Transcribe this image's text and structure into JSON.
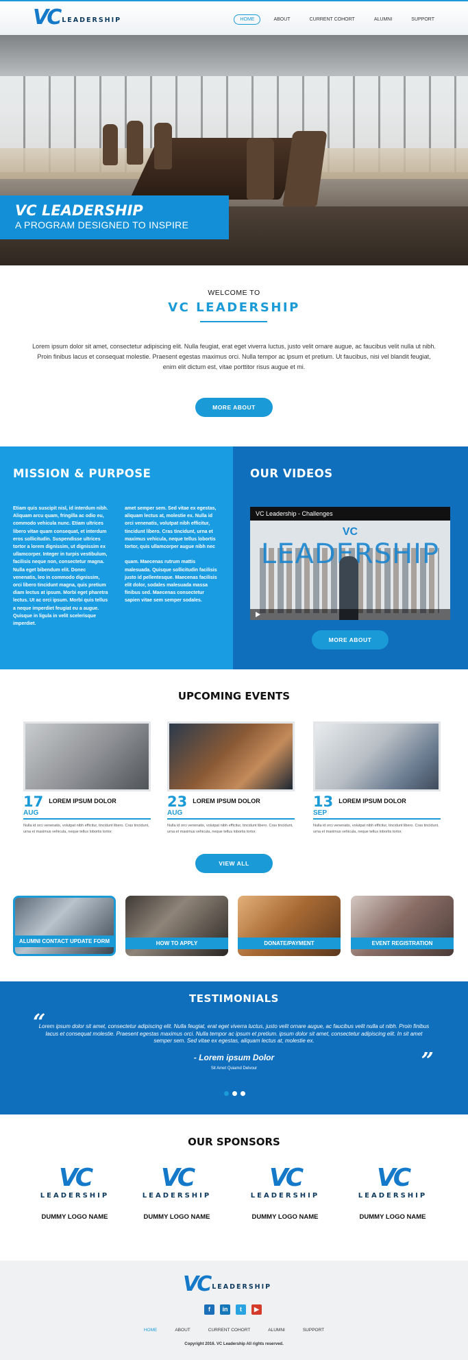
{
  "brand": {
    "vc": "VC",
    "word": "LEADERSHIP"
  },
  "nav": [
    "HOME",
    "ABOUT",
    "CURRENT COHORT",
    "ALUMNI",
    "SUPPORT"
  ],
  "hero": {
    "title": "VC LEADERSHIP",
    "subtitle": "A PROGRAM DESIGNED TO INSPIRE"
  },
  "welcome": {
    "pre": "WELCOME TO",
    "title": "VC LEADERSHIP",
    "text": "Lorem ipsum dolor sit amet, consectetur adipiscing elit. Nulla feugiat, erat eget viverra luctus, justo velit ornare augue, ac faucibus velit nulla ut nibh. Proin finibus lacus et consequat molestie. Praesent egestas maximus orci. Nulla tempor ac ipsum et pretium. Ut faucibus, nisi vel blandit feugiat, enim elit dictum est, vitae porttitor risus augue et mi.",
    "button": "MORE ABOUT"
  },
  "mission": {
    "heading": "MISSION & PURPOSE",
    "col1": "Etiam quis suscipit nisl, id interdum nibh. Aliquam arcu quam, fringilla ac odio eu, commodo vehicula nunc. Etiam ultrices libero vitae quam consequat, et interdum eros sollicitudin. Suspendisse ultrices tortor a lorem dignissim, ut dignissim ex ullamcorper. Integer in turpis vestibulum, facilisis neque non, consectetur magna. Nulla eget bibendum elit. Donec venenatis, leo in commodo dignissim, orci libero tincidunt magna, quis pretium diam lectus at ipsum. Morbi eget pharetra lectus. Ut ac orci ipsum. Morbi quis tellus a neque imperdiet feugiat eu a augue. Quisque in ligula in velit scelerisque imperdiet.",
    "col2": "amet semper sem. Sed vitae ex egestas, aliquam lectus at, molestie ex. Nulla id orci venenatis, volutpat nibh efficitur, tincidunt libero. Cras tincidunt, urna et maximus vehicula, neque tellus lobortis tortor, quis ullamcorper augue nibh nec\n\nquam. Maecenas rutrum mattis malesuada. Quisque sollicitudin facilisis justo id pellentesque. Maecenas facilisis elit dolor, sodales malesuada massa finibus sed. Maecenas consectetur sapien vitae sem semper sodales."
  },
  "videos": {
    "heading": "OUR VIDEOS",
    "video_title": "VC Leadership - Challenges",
    "overlay_vc": "VC",
    "overlay_word": "LEADERSHIP",
    "button": "MORE ABOUT"
  },
  "events": {
    "heading": "UPCOMING EVENTS",
    "items": [
      {
        "day": "17",
        "month": "AUG",
        "title": "LOREM IPSUM DOLOR",
        "text": "Nulla id orci venenatis, volutpat nibh efficitur, tincidunt libero. Cras tincidunt, urna et maximus vehicula, neque tellus lobortis tortor."
      },
      {
        "day": "23",
        "month": "AUG",
        "title": "LOREM IPSUM DOLOR",
        "text": "Nulla id orci venenatis, volutpat nibh efficitur, tincidunt libero. Cras tincidunt, urna et maximus vehicula, neque tellus lobortis tortor."
      },
      {
        "day": "13",
        "month": "SEP",
        "title": "LOREM IPSUM DOLOR",
        "text": "Nulla id orci venenatis, volutpat nibh efficitur, tincidunt libero. Cras tincidunt, urna et maximus vehicula, neque tellus lobortis tortor."
      }
    ],
    "button": "VIEW ALL"
  },
  "quick_links": [
    "ALUMNI CONTACT UPDATE FORM",
    "HOW TO APPLY",
    "DONATE/PAYMENT",
    "EVENT REGISTRATION"
  ],
  "testimonials": {
    "heading": "TESTIMONIALS",
    "open_quote": "“",
    "close_quote": "”",
    "text": "Lorem ipsum dolor sit amet, consectetur adipiscing elit. Nulla feugiat, erat eget viverra luctus, justo velit ornare augue, ac faucibus velit nulla ut nibh. Proin finibus lacus et consequat molestie. Praesent egestas maximus orci. Nulla tempor ac ipsum et pretium. ipsum dolor sit amet, consectetur adipiscing elit. In sit amet semper sem. Sed vitae ex egestas, aliquam lectus at, molestie ex.",
    "name": "- Lorem ipsum Dolor",
    "role": "Sit Amet Quiamd Delvour"
  },
  "sponsors": {
    "heading": "OUR SPONSORS",
    "items": [
      "DUMMY LOGO NAME",
      "DUMMY LOGO NAME",
      "DUMMY LOGO NAME",
      "DUMMY LOGO NAME"
    ]
  },
  "footer": {
    "social": [
      "f",
      "in",
      "t",
      "▶"
    ],
    "nav": [
      "HOME",
      "ABOUT",
      "CURRENT COHORT",
      "ALUMNI",
      "SUPPORT"
    ],
    "copyright": "Copyright 2016. VC Leadership All rights reserved."
  },
  "colors": {
    "accent": "#1a9ad6",
    "dark_blue": "#0f6fbd",
    "navy": "#0d3a5e"
  }
}
